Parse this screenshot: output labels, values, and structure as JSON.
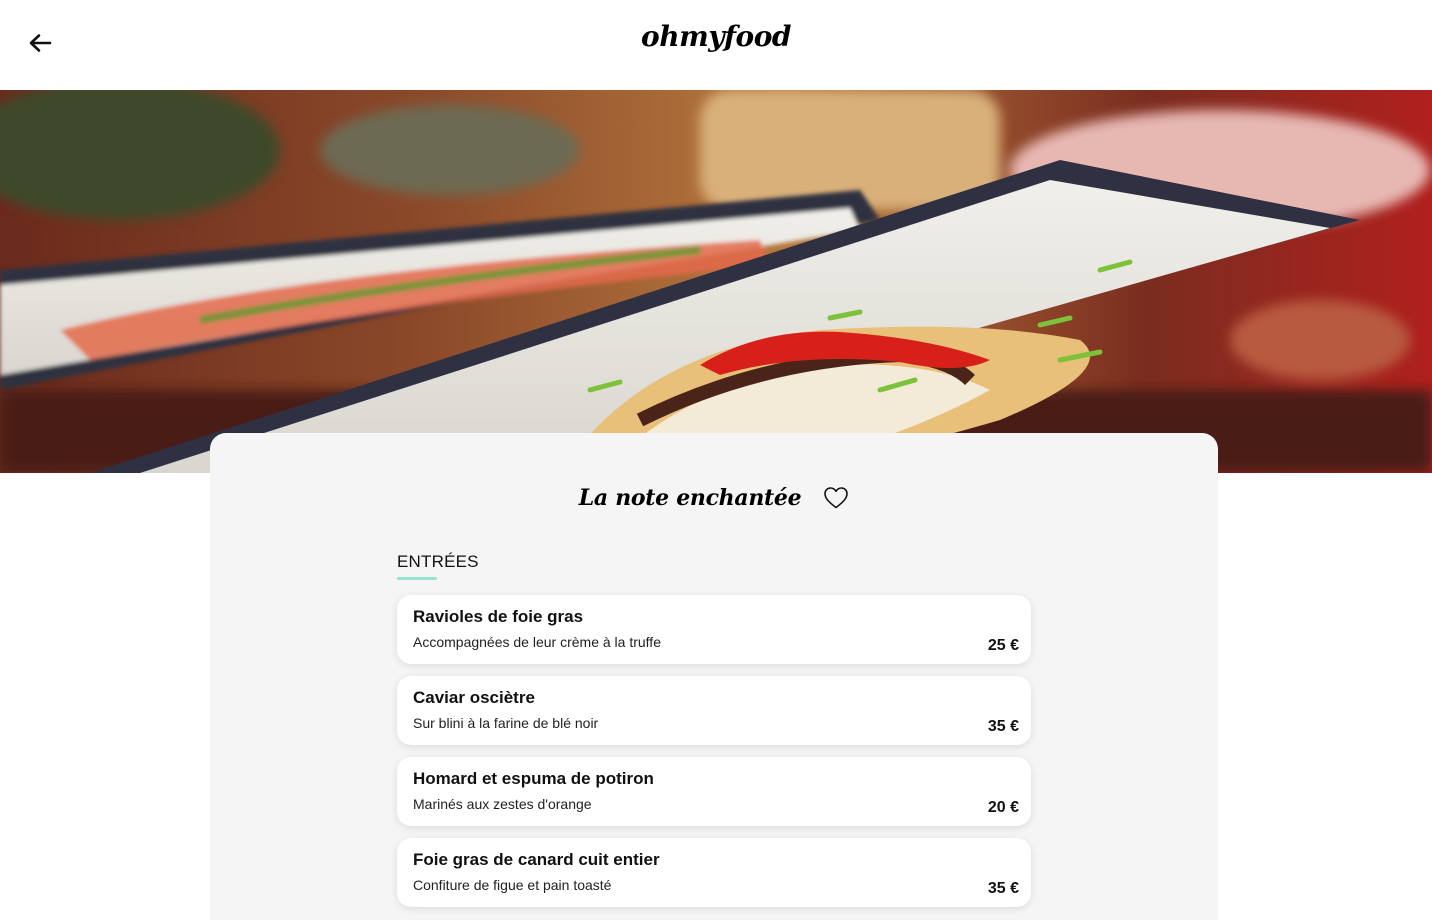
{
  "header": {
    "back_icon": "arrow-left-icon",
    "logo": "ohmyfood"
  },
  "hero": {
    "image": "restaurant-dish-photo"
  },
  "restaurant": {
    "name": "La note enchantée",
    "favorite_icon": "heart-outline-icon"
  },
  "section": {
    "label": "ENTRÉES",
    "accent_color": "#99E2D0"
  },
  "dishes": [
    {
      "name": "Ravioles de foie gras",
      "description": "Accompagnées de leur crème à la truffe",
      "price": "25 €"
    },
    {
      "name": "Caviar osciètre",
      "description": "Sur blini à la farine de blé noir",
      "price": "35 €"
    },
    {
      "name": "Homard et espuma de potiron",
      "description": "Marinés aux zestes d'orange",
      "price": "20 €"
    },
    {
      "name": "Foie gras de canard cuit entier",
      "description": "Confiture de figue et pain toasté",
      "price": "35 €"
    }
  ]
}
